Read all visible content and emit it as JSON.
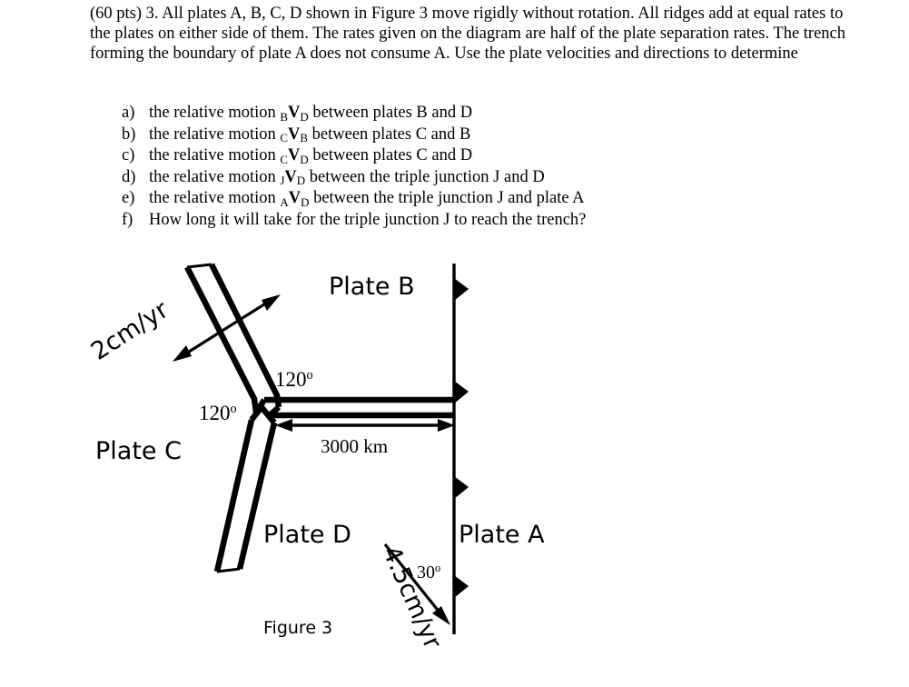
{
  "problem": {
    "paragraph": "(60 pts) 3. All plates A, B, C, D shown in Figure 3 move rigidly without rotation. All ridges add at equal rates to the plates on either side of them. The rates given on the diagram are half of the plate separation rates. The trench forming the boundary of plate A does not consume A. Use the plate velocities and directions to determine"
  },
  "questions": [
    {
      "marker": "a)",
      "pre": "the relative motion ",
      "sub_left": "B",
      "vec": "V",
      "sub_right": "D",
      "post": " between plates B and D"
    },
    {
      "marker": "b)",
      "pre": "the relative motion ",
      "sub_left": "C",
      "vec": "V",
      "sub_right": "B",
      "post": " between plates C and B"
    },
    {
      "marker": "c)",
      "pre": "the relative motion ",
      "sub_left": "C",
      "vec": "V",
      "sub_right": "D",
      "post": " between plates C and D"
    },
    {
      "marker": "d)",
      "pre": "the relative motion ",
      "sub_left": "J",
      "vec": "V",
      "sub_right": "D",
      "post": " between the triple junction J and D"
    },
    {
      "marker": "e)",
      "pre": "the relative motion ",
      "sub_left": "A",
      "vec": "V",
      "sub_right": "D",
      "post": " between the triple junction J and plate A"
    },
    {
      "marker": "f)",
      "pre": "How long it will take for the triple junction J to reach the trench?",
      "sub_left": "",
      "vec": "",
      "sub_right": "",
      "post": ""
    }
  ],
  "figure": {
    "caption": "Figure 3",
    "plates": {
      "a": "Plate A",
      "b": "Plate B",
      "c": "Plate C",
      "d": "Plate D"
    },
    "angles": {
      "upper_120": "120",
      "lower_120": "120",
      "trench_30": "30",
      "degree_symbol": "o"
    },
    "rates": {
      "ridge_rate": "2cm/yr",
      "plate_a_rate": "4.5cm/yr"
    },
    "distance": "3000 km",
    "colors": {
      "ink": "#000000",
      "background": "#ffffff"
    }
  }
}
